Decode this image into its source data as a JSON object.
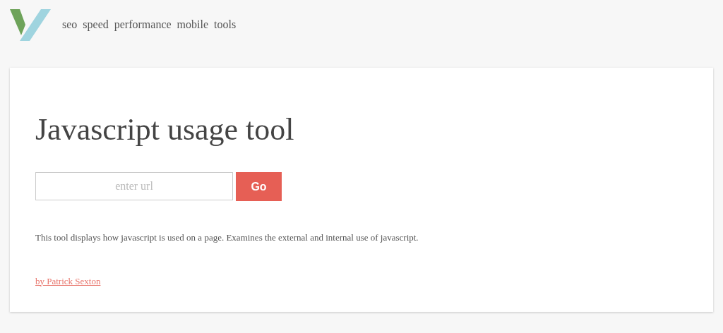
{
  "nav": [
    "seo",
    "speed",
    "performance",
    "mobile",
    "tools"
  ],
  "title": "Javascript usage tool",
  "url_field": {
    "placeholder": "enter url"
  },
  "go_button": "Go",
  "description": "This tool displays how javascript is used on a page. Examines the external and internal use of javascript.",
  "author_link": "by Patrick Sexton"
}
